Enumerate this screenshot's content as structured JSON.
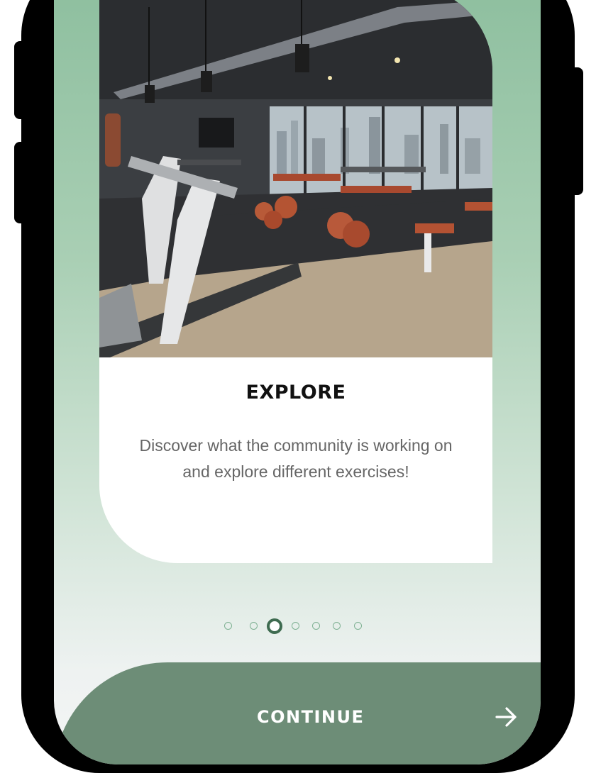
{
  "onboarding": {
    "step": {
      "title": "EXPLORE",
      "description": "Discover what the community is working on and explore different exercises!",
      "image": "gym-interior-photo"
    },
    "pager": {
      "total": 7,
      "current": 3
    },
    "continue_label": "CONTINUE",
    "next_icon": "arrow-right-icon"
  },
  "colors": {
    "gradient_top": "#8ebf9f",
    "gradient_bottom": "#f4f5f5",
    "button": "#6d8d77",
    "dot_active": "#3e6b50",
    "dot_inactive": "#7fb193"
  }
}
